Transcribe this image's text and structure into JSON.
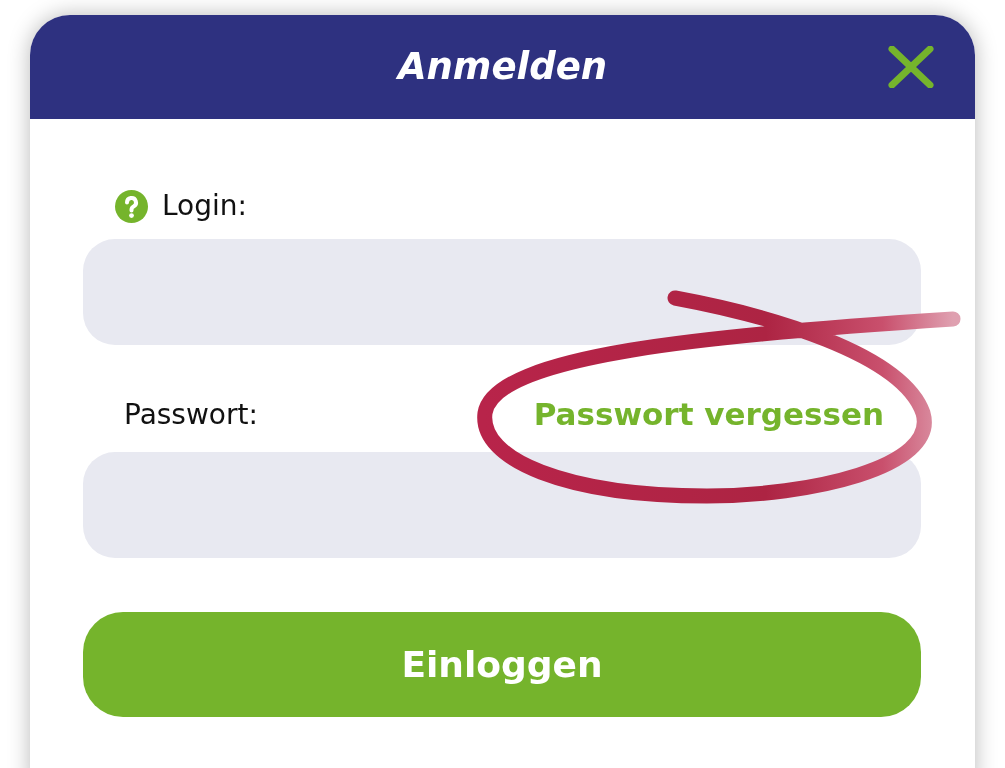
{
  "dialog": {
    "title": "Anmelden"
  },
  "fields": [
    {
      "label": "Login:",
      "help": true
    },
    {
      "label": "Passwort:",
      "help": false,
      "link": {
        "text": "Passwort vergessen",
        "circled": true
      }
    }
  ],
  "submit_button": {
    "label": "Einloggen"
  }
}
